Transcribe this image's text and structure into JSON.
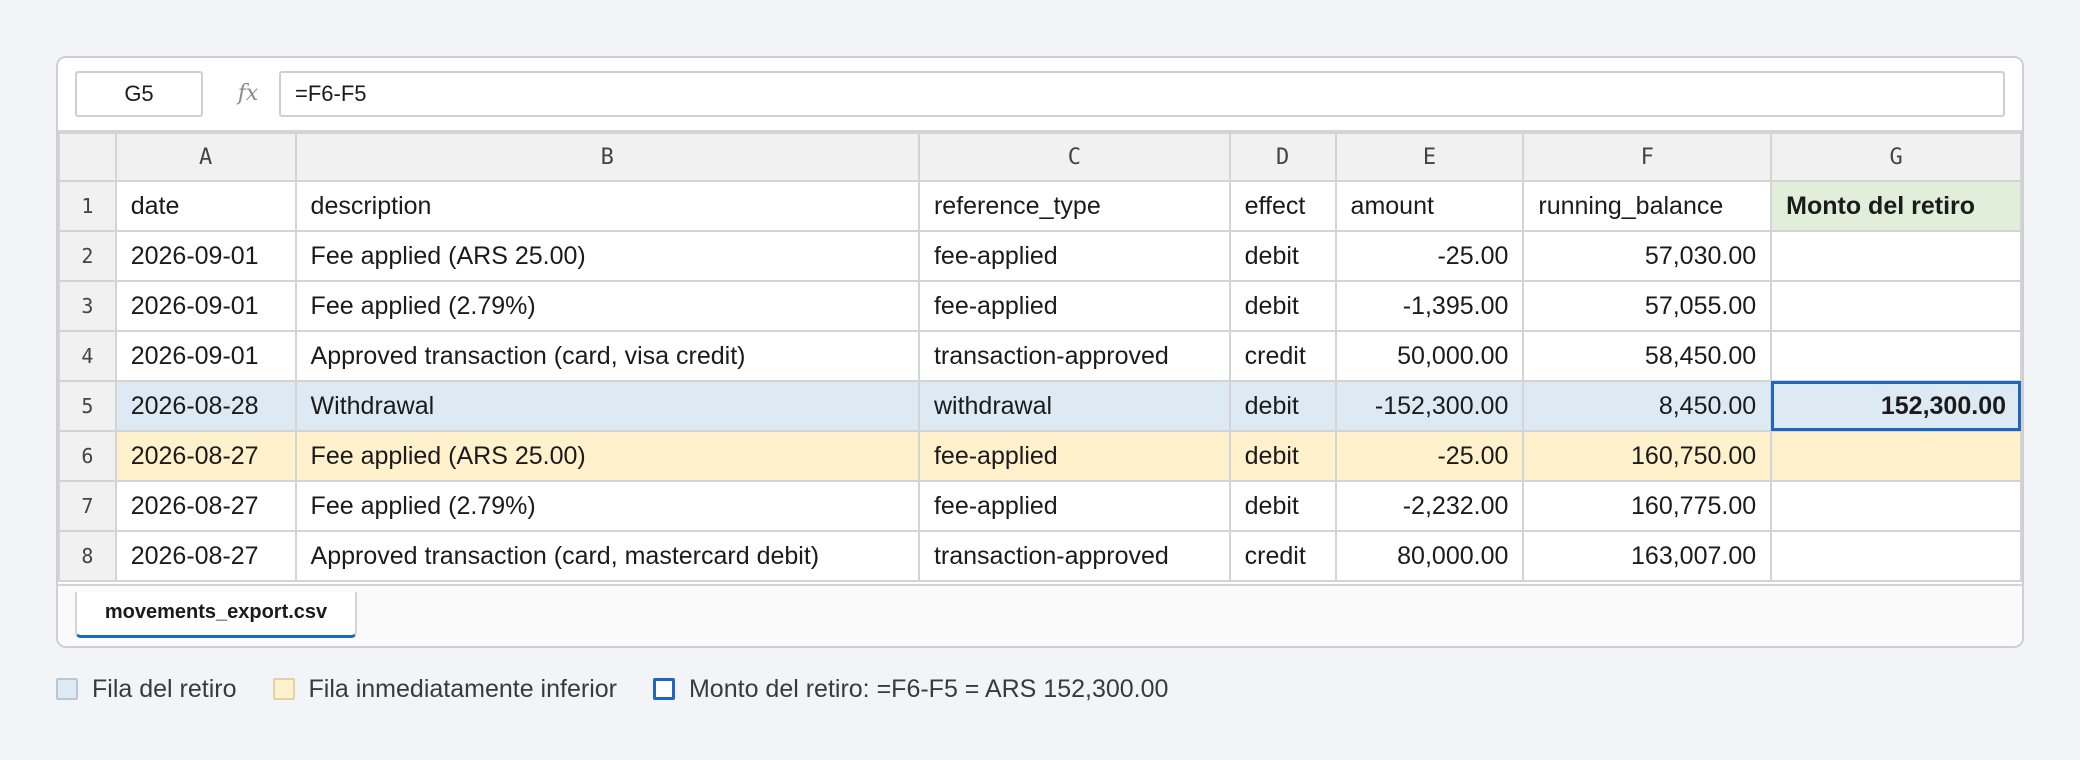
{
  "formula_bar": {
    "name_box": "G5",
    "fx_label": "fx",
    "formula": "=F6-F5"
  },
  "columns": [
    "A",
    "B",
    "C",
    "D",
    "E",
    "F",
    "G"
  ],
  "header_row": {
    "number": "1",
    "cells": [
      "date",
      "description",
      "reference_type",
      "effect",
      "amount",
      "running_balance",
      "Monto del retiro"
    ]
  },
  "rows": [
    {
      "number": "2",
      "cells": [
        "2026-09-01",
        "Fee applied (ARS 25.00)",
        "fee-applied",
        "debit",
        "-25.00",
        "57,030.00",
        ""
      ]
    },
    {
      "number": "3",
      "cells": [
        "2026-09-01",
        "Fee applied (2.79%)",
        "fee-applied",
        "debit",
        "-1,395.00",
        "57,055.00",
        ""
      ]
    },
    {
      "number": "4",
      "cells": [
        "2026-09-01",
        "Approved transaction (card, visa credit)",
        "transaction-approved",
        "credit",
        "50,000.00",
        "58,450.00",
        ""
      ]
    },
    {
      "number": "5",
      "cells": [
        "2026-08-28",
        "Withdrawal",
        "withdrawal",
        "debit",
        "-152,300.00",
        "8,450.00",
        "152,300.00"
      ]
    },
    {
      "number": "6",
      "cells": [
        "2026-08-27",
        "Fee applied (ARS 25.00)",
        "fee-applied",
        "debit",
        "-25.00",
        "160,750.00",
        ""
      ]
    },
    {
      "number": "7",
      "cells": [
        "2026-08-27",
        "Fee applied (2.79%)",
        "fee-applied",
        "debit",
        "-2,232.00",
        "160,775.00",
        ""
      ]
    },
    {
      "number": "8",
      "cells": [
        "2026-08-27",
        "Approved transaction (card, mastercard debit)",
        "transaction-approved",
        "credit",
        "80,000.00",
        "163,007.00",
        ""
      ]
    }
  ],
  "sheet_tab": "movements_export.csv",
  "legend": {
    "withdrawal_row": "Fila del retiro",
    "row_below": "Fila inmediatamente inferior",
    "amount": "Monto del retiro: =F6-F5 = ARS 152,300.00"
  },
  "colors": {
    "withdrawal_row": "#dde9f3",
    "row_below": "#fff1cc",
    "selection": "#1f66c1",
    "header_g": "#e1efda"
  }
}
